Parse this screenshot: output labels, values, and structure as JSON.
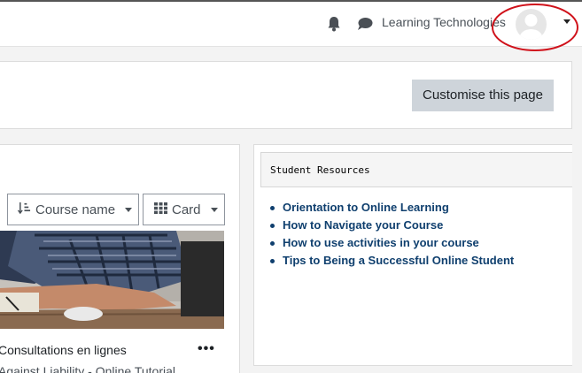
{
  "navbar": {
    "user_name": "Learning Technologies",
    "icons": [
      "bell-icon",
      "chat-icon",
      "avatar",
      "chevron-down-icon"
    ]
  },
  "header": {
    "customise_label": "Customise this page"
  },
  "courses": {
    "sort_label": "Course name",
    "view_label": "Card",
    "course_title": "Consultations en lignes",
    "course_subtitle": "Against Liability - Online Tutorial",
    "more_label": "•••"
  },
  "resources": {
    "title": "Student Resources",
    "links": [
      "Orientation to Online Learning",
      "How to Navigate your Course",
      "How to use activities in your course",
      "Tips to Being a Successful Online Student"
    ]
  },
  "colors": {
    "link": "#0f3f6e",
    "highlight_ring": "#d0121b",
    "button_secondary": "#ced4da"
  }
}
